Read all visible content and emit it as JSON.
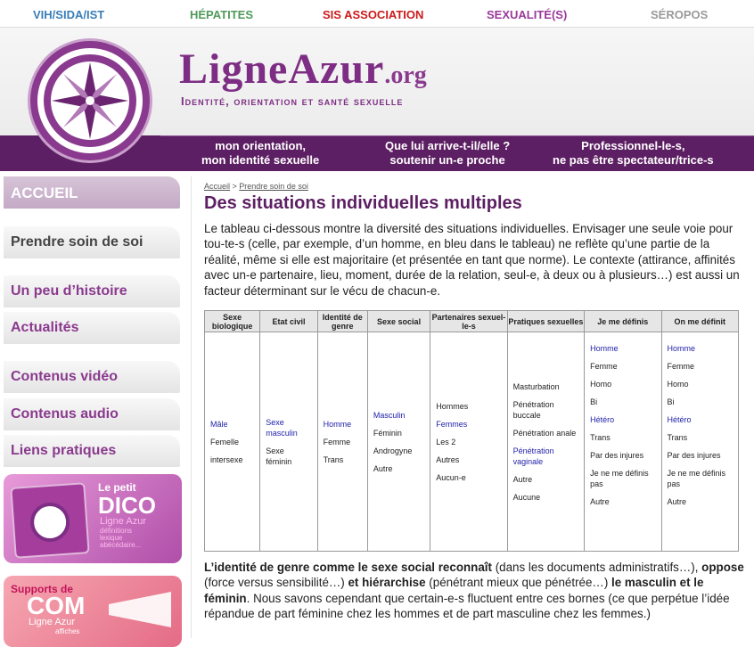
{
  "topnav": [
    {
      "label": "VIH/SIDA/IST",
      "color": "#3a7db8"
    },
    {
      "label": "HÉPATITES",
      "color": "#4f9a5a"
    },
    {
      "label": "SIS ASSOCIATION",
      "color": "#cc1a1a"
    },
    {
      "label": "SEXUALITÉ(S)",
      "color": "#9a3a9a"
    },
    {
      "label": "SÉROPOS",
      "color": "#9a9a9a"
    }
  ],
  "brand": {
    "name": "LigneAzur",
    "domain": ".org",
    "tagline": "Identité, orientation et santé sexuelle"
  },
  "banner": [
    {
      "line1": "mon orientation,",
      "line2": "mon identité sexuelle"
    },
    {
      "line1": "Que lui arrive-t-il/elle ?",
      "line2": "soutenir un-e proche"
    },
    {
      "line1": "Professionnel-le-s,",
      "line2": "ne pas être spectateur/trice-s"
    }
  ],
  "sidebar": {
    "items": [
      "ACCUEIL",
      "Prendre soin de soi",
      "Un peu d’histoire",
      "Actualités",
      "Contenus vidéo",
      "Contenus audio",
      "Liens pratiques"
    ],
    "dico": {
      "small": "Le petit",
      "big": "DICO",
      "brand": "Ligne Azur",
      "desc1": "définitions",
      "desc2": "lexique",
      "desc3": "abécédaire..."
    },
    "com": {
      "small": "Supports de",
      "big": "COM",
      "brand": "Ligne Azur",
      "desc1": "affiches"
    }
  },
  "breadcrumb": {
    "home": "Accueil",
    "sep": " > ",
    "current": "Prendre soin de soi"
  },
  "title": "Des situations individuelles multiples",
  "intro": "Le tableau ci-dessous montre la diversité des situations individuelles. Envisager une seule voie pour tou-te-s (celle, par exemple, d’un homme, en bleu dans le tableau) ne reflète qu’une partie de la réalité, même si elle est majoritaire (et présentée en tant que norme). Le contexte (attirance, affinités avec un-e partenaire, lieu, moment, durée de la relation, seul-e, à deux ou à plusieurs…) est aussi un facteur déterminant sur le vécu de chacun-e.",
  "table": {
    "headers": [
      "Sexe biologique",
      "Etat civil",
      "Identité de genre",
      "Sexe social",
      "Partenaires sexuel-le-s",
      "Pratiques sexuelles",
      "Je me définis",
      "On me définit"
    ],
    "columns": [
      [
        {
          "t": "Mâle",
          "b": true
        },
        {
          "t": "Femelle",
          "b": false
        },
        {
          "t": "intersexe",
          "b": false
        }
      ],
      [
        {
          "t": "Sexe masculin",
          "b": true
        },
        {
          "t": "Sexe féminin",
          "b": false
        }
      ],
      [
        {
          "t": "Homme",
          "b": true
        },
        {
          "t": "Femme",
          "b": false
        },
        {
          "t": "Trans",
          "b": false
        }
      ],
      [
        {
          "t": "Masculin",
          "b": true
        },
        {
          "t": "Féminin",
          "b": false
        },
        {
          "t": "Androgyne",
          "b": false
        },
        {
          "t": "Autre",
          "b": false
        }
      ],
      [
        {
          "t": "Hommes",
          "b": false
        },
        {
          "t": "Femmes",
          "b": true
        },
        {
          "t": "Les 2",
          "b": false
        },
        {
          "t": "Autres",
          "b": false
        },
        {
          "t": "Aucun-e",
          "b": false
        }
      ],
      [
        {
          "t": "Masturbation",
          "b": false
        },
        {
          "t": "Pénétration buccale",
          "b": false
        },
        {
          "t": "Pénétration anale",
          "b": false
        },
        {
          "t": "Pénétration vaginale",
          "b": true
        },
        {
          "t": "Autre",
          "b": false
        },
        {
          "t": "Aucune",
          "b": false
        }
      ],
      [
        {
          "t": "Homme",
          "b": true
        },
        {
          "t": "Femme",
          "b": false
        },
        {
          "t": "Homo",
          "b": false
        },
        {
          "t": "Bi",
          "b": false
        },
        {
          "t": "Hétéro",
          "b": true
        },
        {
          "t": "Trans",
          "b": false
        },
        {
          "t": "Par des injures",
          "b": false
        },
        {
          "t": "Je ne me définis pas",
          "b": false
        },
        {
          "t": "Autre",
          "b": false
        }
      ],
      [
        {
          "t": "Homme",
          "b": true
        },
        {
          "t": "Femme",
          "b": false
        },
        {
          "t": "Homo",
          "b": false
        },
        {
          "t": "Bi",
          "b": false
        },
        {
          "t": "Hétéro",
          "b": true
        },
        {
          "t": "Trans",
          "b": false
        },
        {
          "t": "Par des injures",
          "b": false
        },
        {
          "t": "Je ne me définis pas",
          "b": false
        },
        {
          "t": "Autre",
          "b": false
        }
      ]
    ]
  },
  "bottom": {
    "b1": "L’identité de genre comme le sexe social reconnaît",
    "t1": " (dans les documents administratifs…), ",
    "b2": "oppose",
    "t2": " (force versus sensibilité…) ",
    "b3": "et hiérarchise",
    "t3": " (pénétrant mieux que pénétrée…) ",
    "b4": "le masculin et le féminin",
    "t4": ". Nous savons cependant que certain-e-s fluctuent entre ces bornes (ce que perpétue l’idée répandue de part féminine chez les hommes et de part masculine chez les femmes.)"
  }
}
